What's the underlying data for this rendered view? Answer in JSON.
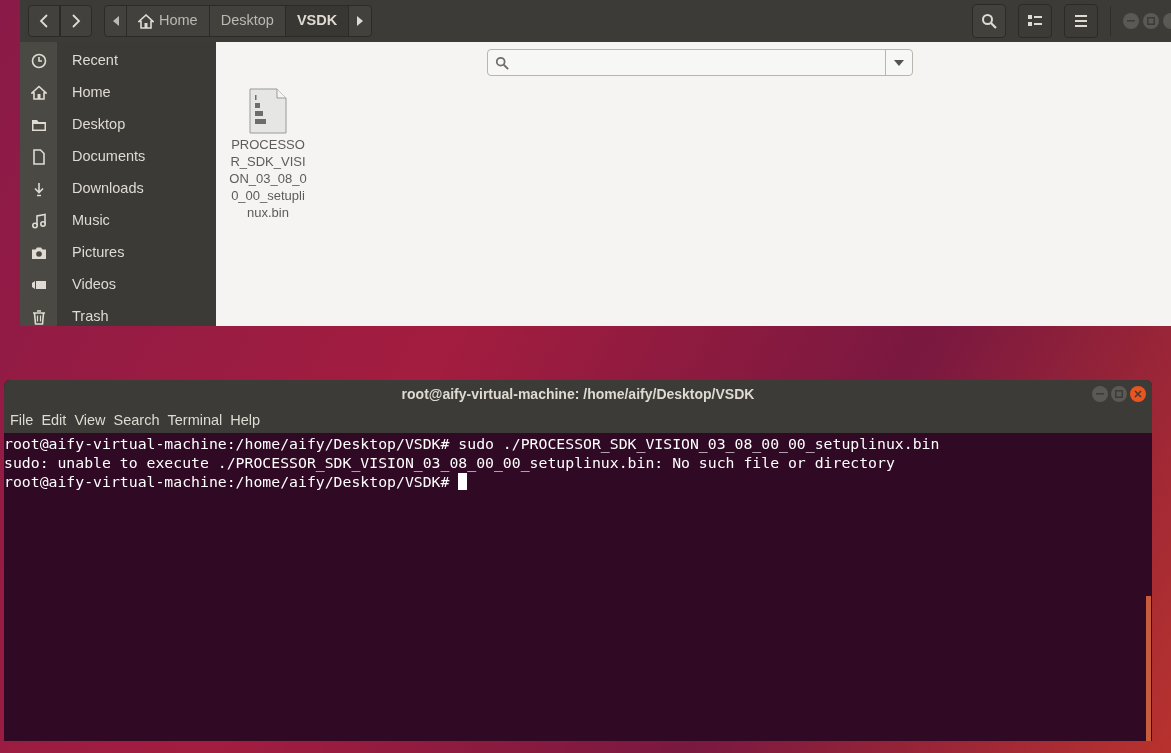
{
  "file_manager": {
    "breadcrumbs": [
      {
        "label": "Home",
        "kind": "home",
        "selected": false
      },
      {
        "label": "Desktop",
        "kind": "folder",
        "selected": false
      },
      {
        "label": "VSDK",
        "kind": "folder",
        "selected": true
      }
    ],
    "sidebar": {
      "items": [
        {
          "label": "Recent"
        },
        {
          "label": "Home"
        },
        {
          "label": "Desktop"
        },
        {
          "label": "Documents"
        },
        {
          "label": "Downloads"
        },
        {
          "label": "Music"
        },
        {
          "label": "Pictures"
        },
        {
          "label": "Videos"
        },
        {
          "label": "Trash"
        }
      ]
    },
    "files": [
      {
        "name": "PROCESSOR_SDK_VISION_03_08_00_00_setuplinux.bin"
      }
    ]
  },
  "terminal": {
    "title": "root@aify-virtual-machine: /home/aify/Desktop/VSDK",
    "menu": [
      "File",
      "Edit",
      "View",
      "Search",
      "Terminal",
      "Help"
    ],
    "lines": [
      "root@aify-virtual-machine:/home/aify/Desktop/VSDK# sudo ./PROCESSOR_SDK_VISION_03_08_00_00_setuplinux.bin",
      "sudo: unable to execute ./PROCESSOR_SDK_VISION_03_08_00_00_setuplinux.bin: No such file or directory",
      "root@aify-virtual-machine:/home/aify/Desktop/VSDK# "
    ]
  }
}
